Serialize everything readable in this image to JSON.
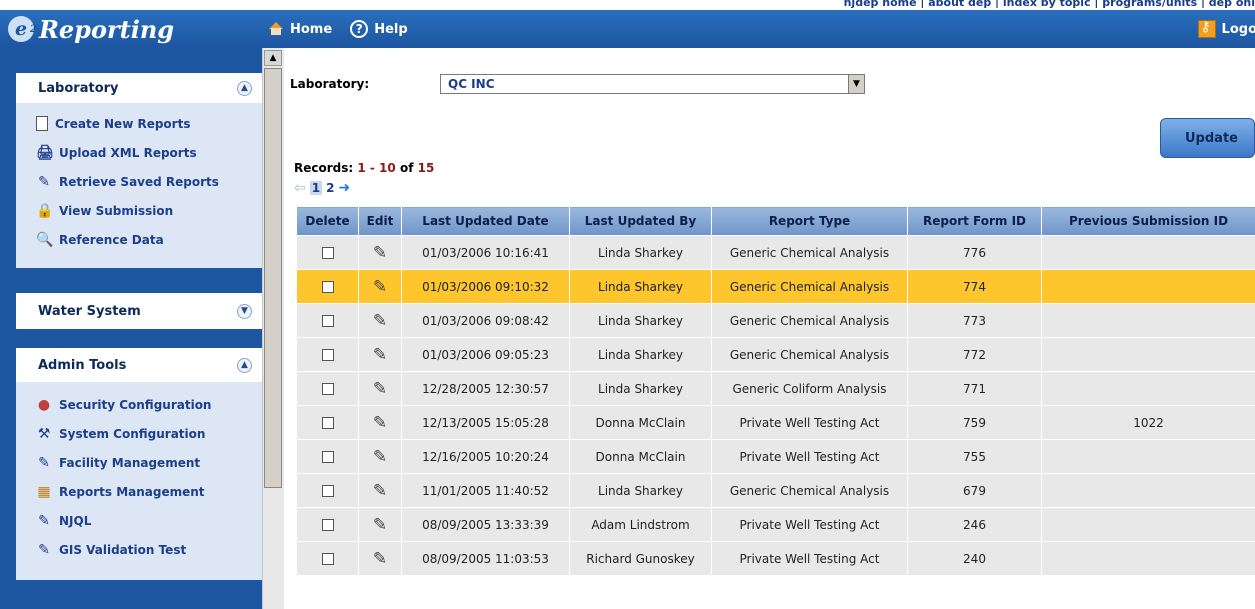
{
  "top_links": "njdep home  |  about dep  |  index by topic  |  programs/units  |  dep onl",
  "header": {
    "logo_e": "e",
    "logo_sup": "2",
    "logo_text": "Reporting",
    "nav": {
      "home": "Home",
      "help": "Help"
    },
    "logout": "Logo"
  },
  "sidebar": {
    "laboratory": {
      "title": "Laboratory",
      "items": [
        {
          "label": "Create New Reports",
          "icon": "document-icon"
        },
        {
          "label": "Upload XML Reports",
          "icon": "upload-xml-icon"
        },
        {
          "label": "Retrieve Saved Reports",
          "icon": "retrieve-icon"
        },
        {
          "label": "View Submission",
          "icon": "view-submission-icon"
        },
        {
          "label": "Reference Data",
          "icon": "reference-data-icon"
        }
      ]
    },
    "water_system": {
      "title": "Water System"
    },
    "admin_tools": {
      "title": "Admin Tools",
      "items": [
        {
          "label": "Security Configuration",
          "icon": "users-icon"
        },
        {
          "label": "System Configuration",
          "icon": "tools-icon"
        },
        {
          "label": "Facility Management",
          "icon": "facility-icon"
        },
        {
          "label": "Reports Management",
          "icon": "reports-icon"
        },
        {
          "label": "NJQL",
          "icon": "njql-icon"
        },
        {
          "label": "GIS Validation Test",
          "icon": "gis-icon"
        }
      ]
    }
  },
  "main": {
    "lab_label": "Laboratory:",
    "lab_value": "QC INC",
    "update_label": "Update",
    "records_prefix": "Records: ",
    "records_range": "1 - 10",
    "records_of": " of ",
    "records_total": "15",
    "pages": [
      "1",
      "2"
    ],
    "columns": [
      "Delete",
      "Edit",
      "Last Updated Date",
      "Last Updated By",
      "Report Type",
      "Report Form ID",
      "Previous Submission ID"
    ],
    "rows": [
      {
        "date": "01/03/2006 10:16:41",
        "by": "Linda Sharkey",
        "type": "Generic Chemical Analysis",
        "form_id": "776",
        "prev_id": ""
      },
      {
        "date": "01/03/2006 09:10:32",
        "by": "Linda Sharkey",
        "type": "Generic Chemical Analysis",
        "form_id": "774",
        "prev_id": ""
      },
      {
        "date": "01/03/2006 09:08:42",
        "by": "Linda Sharkey",
        "type": "Generic Chemical Analysis",
        "form_id": "773",
        "prev_id": ""
      },
      {
        "date": "01/03/2006 09:05:23",
        "by": "Linda Sharkey",
        "type": "Generic Chemical Analysis",
        "form_id": "772",
        "prev_id": ""
      },
      {
        "date": "12/28/2005 12:30:57",
        "by": "Linda Sharkey",
        "type": "Generic Coliform Analysis",
        "form_id": "771",
        "prev_id": ""
      },
      {
        "date": "12/13/2005 15:05:28",
        "by": "Donna McClain",
        "type": "Private Well Testing Act",
        "form_id": "759",
        "prev_id": "1022"
      },
      {
        "date": "12/16/2005 10:20:24",
        "by": "Donna McClain",
        "type": "Private Well Testing Act",
        "form_id": "755",
        "prev_id": ""
      },
      {
        "date": "11/01/2005 11:40:52",
        "by": "Linda Sharkey",
        "type": "Generic Chemical Analysis",
        "form_id": "679",
        "prev_id": ""
      },
      {
        "date": "08/09/2005 13:33:39",
        "by": "Adam Lindstrom",
        "type": "Private Well Testing Act",
        "form_id": "246",
        "prev_id": ""
      },
      {
        "date": "08/09/2005 11:03:53",
        "by": "Richard Gunoskey",
        "type": "Private Well Testing Act",
        "form_id": "240",
        "prev_id": ""
      }
    ],
    "selected_row": 1
  },
  "colors": {
    "header_blue": "#1c55a0",
    "highlight_row": "#fcc62c",
    "table_header": "#7f9fcf"
  }
}
